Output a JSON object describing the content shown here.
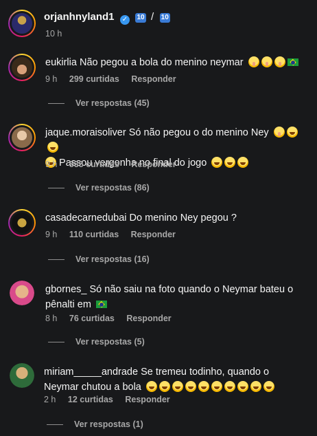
{
  "post": {
    "username": "orjanhnyland1",
    "badges": [
      "10",
      "/",
      "10"
    ],
    "time": "10 h"
  },
  "colors": {
    "background": "#18191b",
    "text": "#f5f5f5",
    "muted": "#a8a8a8",
    "verified": "#3897f0"
  },
  "comments": [
    {
      "username": "eukirlia",
      "text": "Não pegou a bola do menino neymar",
      "text2": "",
      "time": "9 h",
      "likes": "299 curtidas",
      "reply": "Responder",
      "replies": "Ver respostas (45)"
    },
    {
      "username": "jaque.moraisoliver",
      "text": "Só não pegou o do menino Ney",
      "text2": "Passou vergonha no final do jogo",
      "time": "9 h",
      "likes": "535 curtidas",
      "reply": "Responder",
      "replies": "Ver respostas (86)"
    },
    {
      "username": "casadecarnedubai",
      "text": "Do menino Ney pegou ?",
      "text2": "",
      "time": "9 h",
      "likes": "110 curtidas",
      "reply": "Responder",
      "replies": "Ver respostas (16)"
    },
    {
      "username": "gbornes_",
      "text": "Só não saiu na foto quando o Neymar bateu o",
      "text2": "pênalti em",
      "time": "8 h",
      "likes": "76 curtidas",
      "reply": "Responder",
      "replies": "Ver respostas (5)"
    },
    {
      "username": "miriam_____andrade",
      "text": "Se tremeu todinho, quando o Neymar",
      "text2": "chutou a bola",
      "time": "2 h",
      "likes": "12 curtidas",
      "reply": "Responder",
      "replies": "Ver respostas (1)"
    }
  ]
}
